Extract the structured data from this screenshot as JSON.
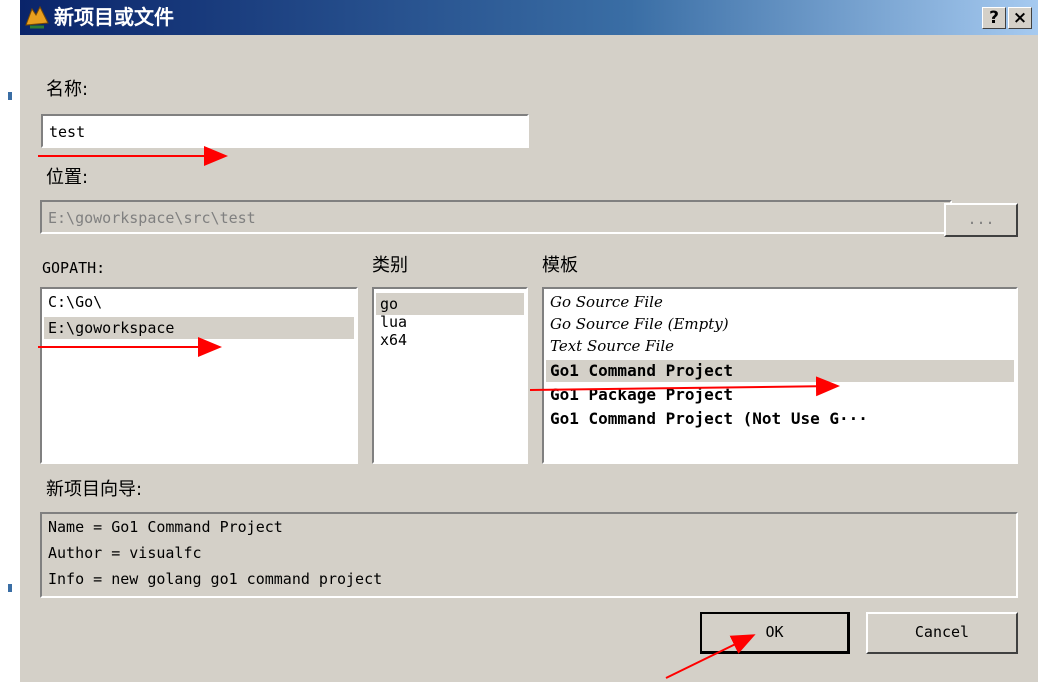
{
  "window": {
    "title": "新项目或文件",
    "help_button": "?",
    "close_button": "×"
  },
  "form": {
    "name_label": "名称:",
    "name_value": "test",
    "location_label": "位置:",
    "location_value": "E:\\goworkspace\\src\\test",
    "browse_label": "...",
    "gopath_label": "GOPATH:",
    "category_label": "类别",
    "template_label": "模板",
    "wizard_label": "新项目向导:"
  },
  "gopath_list": [
    {
      "label": "C:\\Go\\",
      "selected": false
    },
    {
      "label": "E:\\goworkspace",
      "selected": true
    }
  ],
  "category_list": [
    {
      "label": "go",
      "selected": true
    },
    {
      "label": "lua",
      "selected": false
    },
    {
      "label": "x64",
      "selected": false
    }
  ],
  "template_list": [
    {
      "label": "Go Source File",
      "style": "italic",
      "selected": false
    },
    {
      "label": "Go Source File (Empty)",
      "style": "italic",
      "selected": false
    },
    {
      "label": "Text Source File",
      "style": "italic",
      "selected": false
    },
    {
      "label": "Go1 Command Project",
      "style": "bold",
      "selected": true
    },
    {
      "label": "Go1 Package Project",
      "style": "bold",
      "selected": false
    },
    {
      "label": "Go1 Command Project (Not Use G···",
      "style": "bold",
      "selected": false
    }
  ],
  "wizard_info": [
    "Name = Go1 Command Project",
    "Author = visualfc",
    "Info = new golang go1 command project"
  ],
  "buttons": {
    "ok": "OK",
    "cancel": "Cancel"
  },
  "colors": {
    "titlebar_start": "#0a246a",
    "dialog_bg": "#d4d0c8",
    "annotation_arrow": "#ff0000"
  }
}
